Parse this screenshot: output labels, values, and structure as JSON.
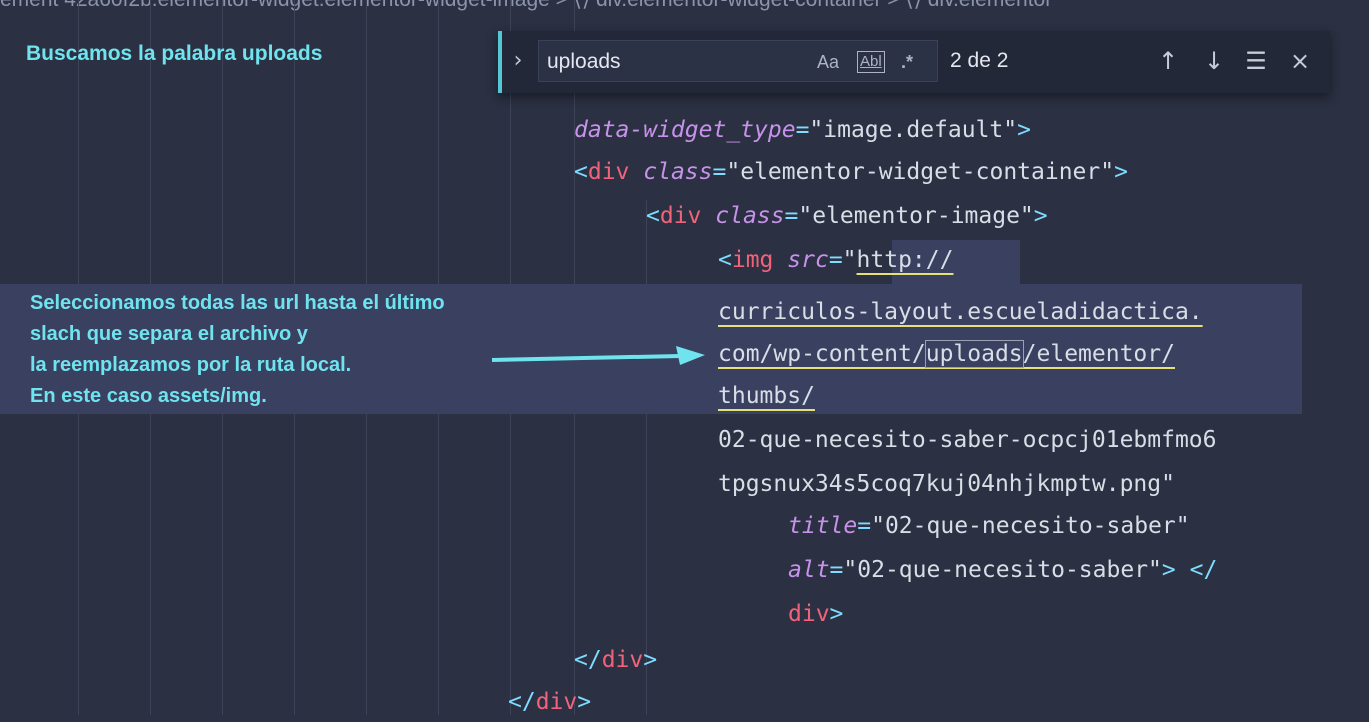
{
  "breadcrumb": "ement 42a60f2b.elementor-widget.elementor-widget-image > ⟨⟩ div.elementor-widget-container > ⟨⟩ div.elementor",
  "annotations": {
    "title": "Buscamos la palabra uploads",
    "lines": [
      "Seleccionamos todas las url hasta el último",
      "slach que separa el archivo y",
      "la reemplazamos por la ruta local.",
      "En este caso assets/img."
    ],
    "color": "#6fe3ee"
  },
  "find_widget": {
    "value": "uploads",
    "match_case": "Aa",
    "whole_word": "Abl",
    "regex": ".*",
    "count": "2 de 2",
    "prev": "↑",
    "next": "↓",
    "in_selection": "☰",
    "close": "×",
    "toggle": "›"
  },
  "code": {
    "l1_attr": "data-widget_type",
    "l1_eq": "=",
    "l1_val": "\"image.default\"",
    "l1_end": ">",
    "l2_open": "<",
    "l2_tag": "div",
    "l2_attr": "class",
    "l2_eq": "=",
    "l2_val": "\"elementor-widget-container\"",
    "l2_end": ">",
    "l3_open": "<",
    "l3_tag": "div",
    "l3_attr": "class",
    "l3_eq": "=",
    "l3_val": "\"elementor-image\"",
    "l3_end": ">",
    "l4_open": "<",
    "l4_tag": "img",
    "l4_attr": "src",
    "l4_eq": "=",
    "l4_quote": "\"",
    "l4_val": "http://",
    "l5_val": "curriculos-layout.escueladidactica.",
    "l6_pre": "com/wp-content/",
    "l6_match": "uploads",
    "l6_post": "/elementor/",
    "l7_val": "thumbs/",
    "l8_val": "02-que-necesito-saber-ocpcj01ebmfmo6",
    "l9_val": "tpgsnux34s5coq7kuj04nhjkmptw.png",
    "l9_quote": "\"",
    "l10_attr": "title",
    "l10_eq": "=",
    "l10_val": "\"02-que-necesito-saber\"",
    "l11_attr": "alt",
    "l11_eq": "=",
    "l11_val": "\"02-que-necesito-saber\"",
    "l11_end": "> </",
    "l12_tag": "div",
    "l12_end": ">",
    "l13_open": "</",
    "l13_tag": "div",
    "l13_end": ">",
    "l14_open": "</",
    "l14_tag": "div",
    "l14_end": ">"
  }
}
